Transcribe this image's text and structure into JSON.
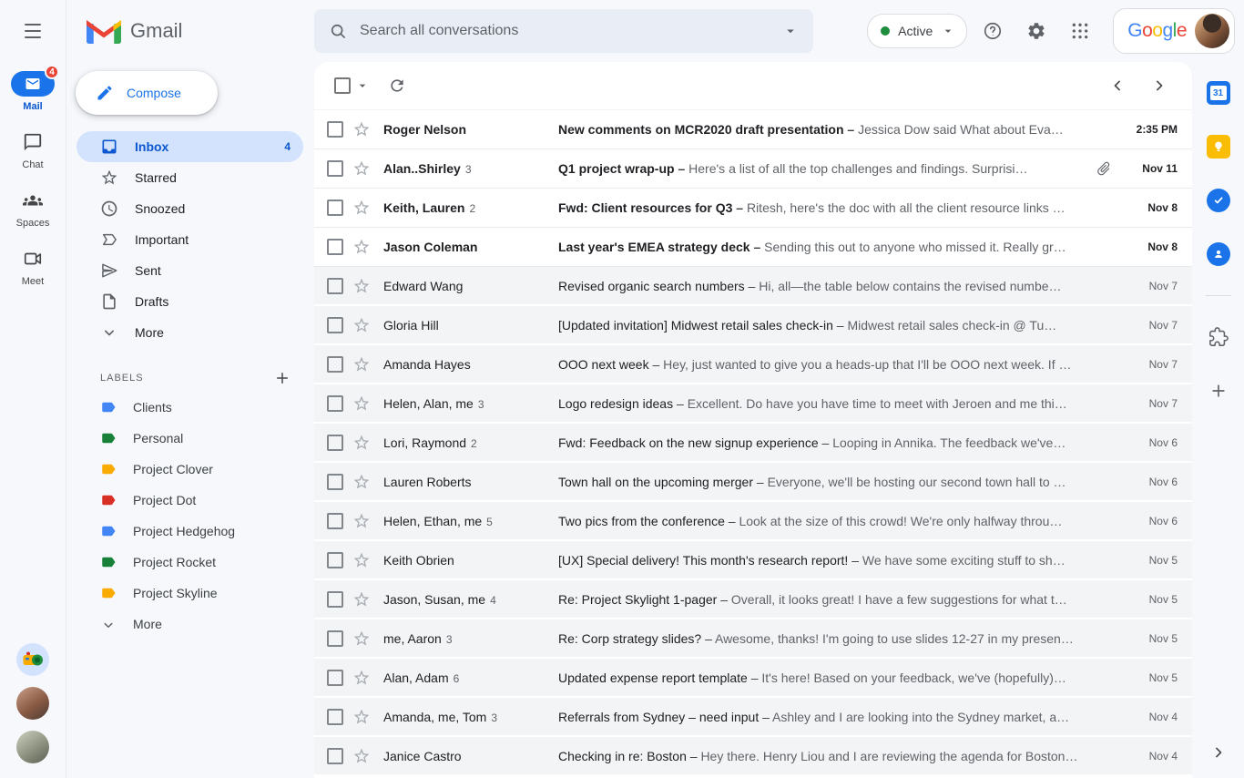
{
  "brand": {
    "app_name": "Gmail"
  },
  "header": {
    "search_placeholder": "Search all conversations",
    "status_label": "Active",
    "google_letters": [
      {
        "ch": "G",
        "color": "#4285F4"
      },
      {
        "ch": "o",
        "color": "#EA4335"
      },
      {
        "ch": "o",
        "color": "#FBBC05"
      },
      {
        "ch": "g",
        "color": "#4285F4"
      },
      {
        "ch": "l",
        "color": "#34A853"
      },
      {
        "ch": "e",
        "color": "#EA4335"
      }
    ]
  },
  "rail": {
    "items": [
      {
        "id": "mail",
        "label": "Mail",
        "badge": "4",
        "active": true
      },
      {
        "id": "chat",
        "label": "Chat",
        "active": false
      },
      {
        "id": "spaces",
        "label": "Spaces",
        "active": false
      },
      {
        "id": "meet",
        "label": "Meet",
        "active": false
      }
    ]
  },
  "sidebar": {
    "compose_label": "Compose",
    "nav": [
      {
        "id": "inbox",
        "label": "Inbox",
        "count": "4",
        "selected": true
      },
      {
        "id": "starred",
        "label": "Starred",
        "selected": false
      },
      {
        "id": "snoozed",
        "label": "Snoozed",
        "selected": false
      },
      {
        "id": "important",
        "label": "Important",
        "selected": false
      },
      {
        "id": "sent",
        "label": "Sent",
        "selected": false
      },
      {
        "id": "drafts",
        "label": "Drafts",
        "selected": false
      },
      {
        "id": "more",
        "label": "More",
        "selected": false
      }
    ],
    "labels_header": "LABELS",
    "labels": [
      {
        "name": "Clients",
        "color": "#4285f4"
      },
      {
        "name": "Personal",
        "color": "#188038"
      },
      {
        "name": "Project Clover",
        "color": "#f9ab00"
      },
      {
        "name": "Project Dot",
        "color": "#d93025"
      },
      {
        "name": "Project Hedgehog",
        "color": "#4285f4"
      },
      {
        "name": "Project Rocket",
        "color": "#188038"
      },
      {
        "name": "Project Skyline",
        "color": "#f9ab00"
      }
    ],
    "labels_more": "More"
  },
  "list": {
    "snippet_separator": "–",
    "rows": [
      {
        "sender": "Roger Nelson",
        "count": "",
        "subject": "New comments on MCR2020 draft presentation",
        "snippet": "Jessica Dow said What about Eva…",
        "date": "2:35 PM",
        "unread": true,
        "attachment": false
      },
      {
        "sender": "Alan..Shirley",
        "count": "3",
        "subject": "Q1 project wrap-up",
        "snippet": "Here's a list of all the top challenges and findings. Surprisi…",
        "date": "Nov 11",
        "unread": true,
        "attachment": true
      },
      {
        "sender": "Keith, Lauren",
        "count": "2",
        "subject": "Fwd: Client resources for Q3",
        "snippet": "Ritesh, here's the doc with all the client resource links …",
        "date": "Nov 8",
        "unread": true,
        "attachment": false
      },
      {
        "sender": "Jason Coleman",
        "count": "",
        "subject": "Last year's EMEA strategy deck",
        "snippet": "Sending this out to anyone who missed it. Really gr…",
        "date": "Nov 8",
        "unread": true,
        "attachment": false
      },
      {
        "sender": "Edward Wang",
        "count": "",
        "subject": "Revised organic search numbers",
        "snippet": "Hi, all—the table below contains the revised numbe…",
        "date": "Nov 7",
        "unread": false,
        "attachment": false
      },
      {
        "sender": "Gloria Hill",
        "count": "",
        "subject": "[Updated invitation] Midwest retail sales check-in",
        "snippet": "Midwest retail sales check-in @ Tu…",
        "date": "Nov 7",
        "unread": false,
        "attachment": false
      },
      {
        "sender": "Amanda Hayes",
        "count": "",
        "subject": "OOO next week",
        "snippet": "Hey, just wanted to give you a heads-up that I'll be OOO next week. If …",
        "date": "Nov 7",
        "unread": false,
        "attachment": false
      },
      {
        "sender": "Helen, Alan, me",
        "count": "3",
        "subject": "Logo redesign ideas",
        "snippet": "Excellent. Do have you have time to meet with Jeroen and me thi…",
        "date": "Nov 7",
        "unread": false,
        "attachment": false
      },
      {
        "sender": "Lori, Raymond",
        "count": "2",
        "subject": "Fwd: Feedback on the new signup experience",
        "snippet": "Looping in Annika. The feedback we've…",
        "date": "Nov 6",
        "unread": false,
        "attachment": false
      },
      {
        "sender": "Lauren Roberts",
        "count": "",
        "subject": "Town hall on the upcoming merger",
        "snippet": "Everyone, we'll be hosting our second town hall to …",
        "date": "Nov 6",
        "unread": false,
        "attachment": false
      },
      {
        "sender": "Helen, Ethan, me",
        "count": "5",
        "subject": "Two pics from the conference",
        "snippet": "Look at the size of this crowd! We're only halfway throu…",
        "date": "Nov 6",
        "unread": false,
        "attachment": false
      },
      {
        "sender": "Keith Obrien",
        "count": "",
        "subject": "[UX] Special delivery! This month's research report!",
        "snippet": "We have some exciting stuff to sh…",
        "date": "Nov 5",
        "unread": false,
        "attachment": false
      },
      {
        "sender": "Jason, Susan, me",
        "count": "4",
        "subject": "Re: Project Skylight 1-pager",
        "snippet": "Overall, it looks great! I have a few suggestions for what t…",
        "date": "Nov 5",
        "unread": false,
        "attachment": false
      },
      {
        "sender": "me, Aaron",
        "count": "3",
        "subject": "Re: Corp strategy slides?",
        "snippet": "Awesome, thanks! I'm going to use slides 12-27 in my presen…",
        "date": "Nov 5",
        "unread": false,
        "attachment": false
      },
      {
        "sender": "Alan, Adam",
        "count": "6",
        "subject": "Updated expense report template",
        "snippet": "It's here! Based on your feedback, we've (hopefully)…",
        "date": "Nov 5",
        "unread": false,
        "attachment": false
      },
      {
        "sender": "Amanda, me, Tom",
        "count": "3",
        "subject": "Referrals from Sydney – need input",
        "snippet": "Ashley and I are looking into the Sydney market, a…",
        "date": "Nov 4",
        "unread": false,
        "attachment": false
      },
      {
        "sender": "Janice Castro",
        "count": "",
        "subject": "Checking in re: Boston",
        "snippet": "Hey there. Henry Liou and I are reviewing the agenda for Boston…",
        "date": "Nov 4",
        "unread": false,
        "attachment": false
      }
    ]
  },
  "right_panel": {
    "calendar_day": "31",
    "icons": [
      "calendar",
      "keep",
      "tasks",
      "contacts",
      "divider",
      "addons",
      "plus"
    ]
  }
}
